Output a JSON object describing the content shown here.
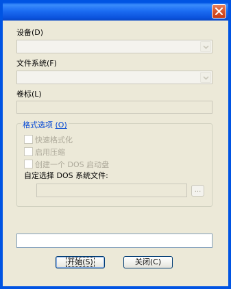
{
  "window": {
    "close_glyph": "close-icon",
    "titlebar_color": "#0054e3",
    "close_color": "#d9542b"
  },
  "device": {
    "label": "设备",
    "mnemonic": "(D)",
    "value": ""
  },
  "filesystem": {
    "label": "文件系统",
    "mnemonic": "(F)",
    "value": ""
  },
  "volume": {
    "label": "卷标",
    "mnemonic": "(L)",
    "value": ""
  },
  "format_options": {
    "title": "格式选项",
    "mnemonic": "(O)",
    "quick_format": {
      "label": "快速格式化",
      "checked": false
    },
    "compression": {
      "label": "启用压缩",
      "checked": false
    },
    "dos_boot": {
      "label": "创建一个 DOS 启动盘",
      "checked": false
    },
    "custom_dos_label": "自定选择 DOS 系统文件:",
    "custom_dos_value": "",
    "browse_label": "..."
  },
  "status_field": {
    "value": ""
  },
  "buttons": {
    "start_label": "开始",
    "start_mnemonic": "(S)",
    "close_label": "关闭",
    "close_mnemonic": "(C)"
  }
}
